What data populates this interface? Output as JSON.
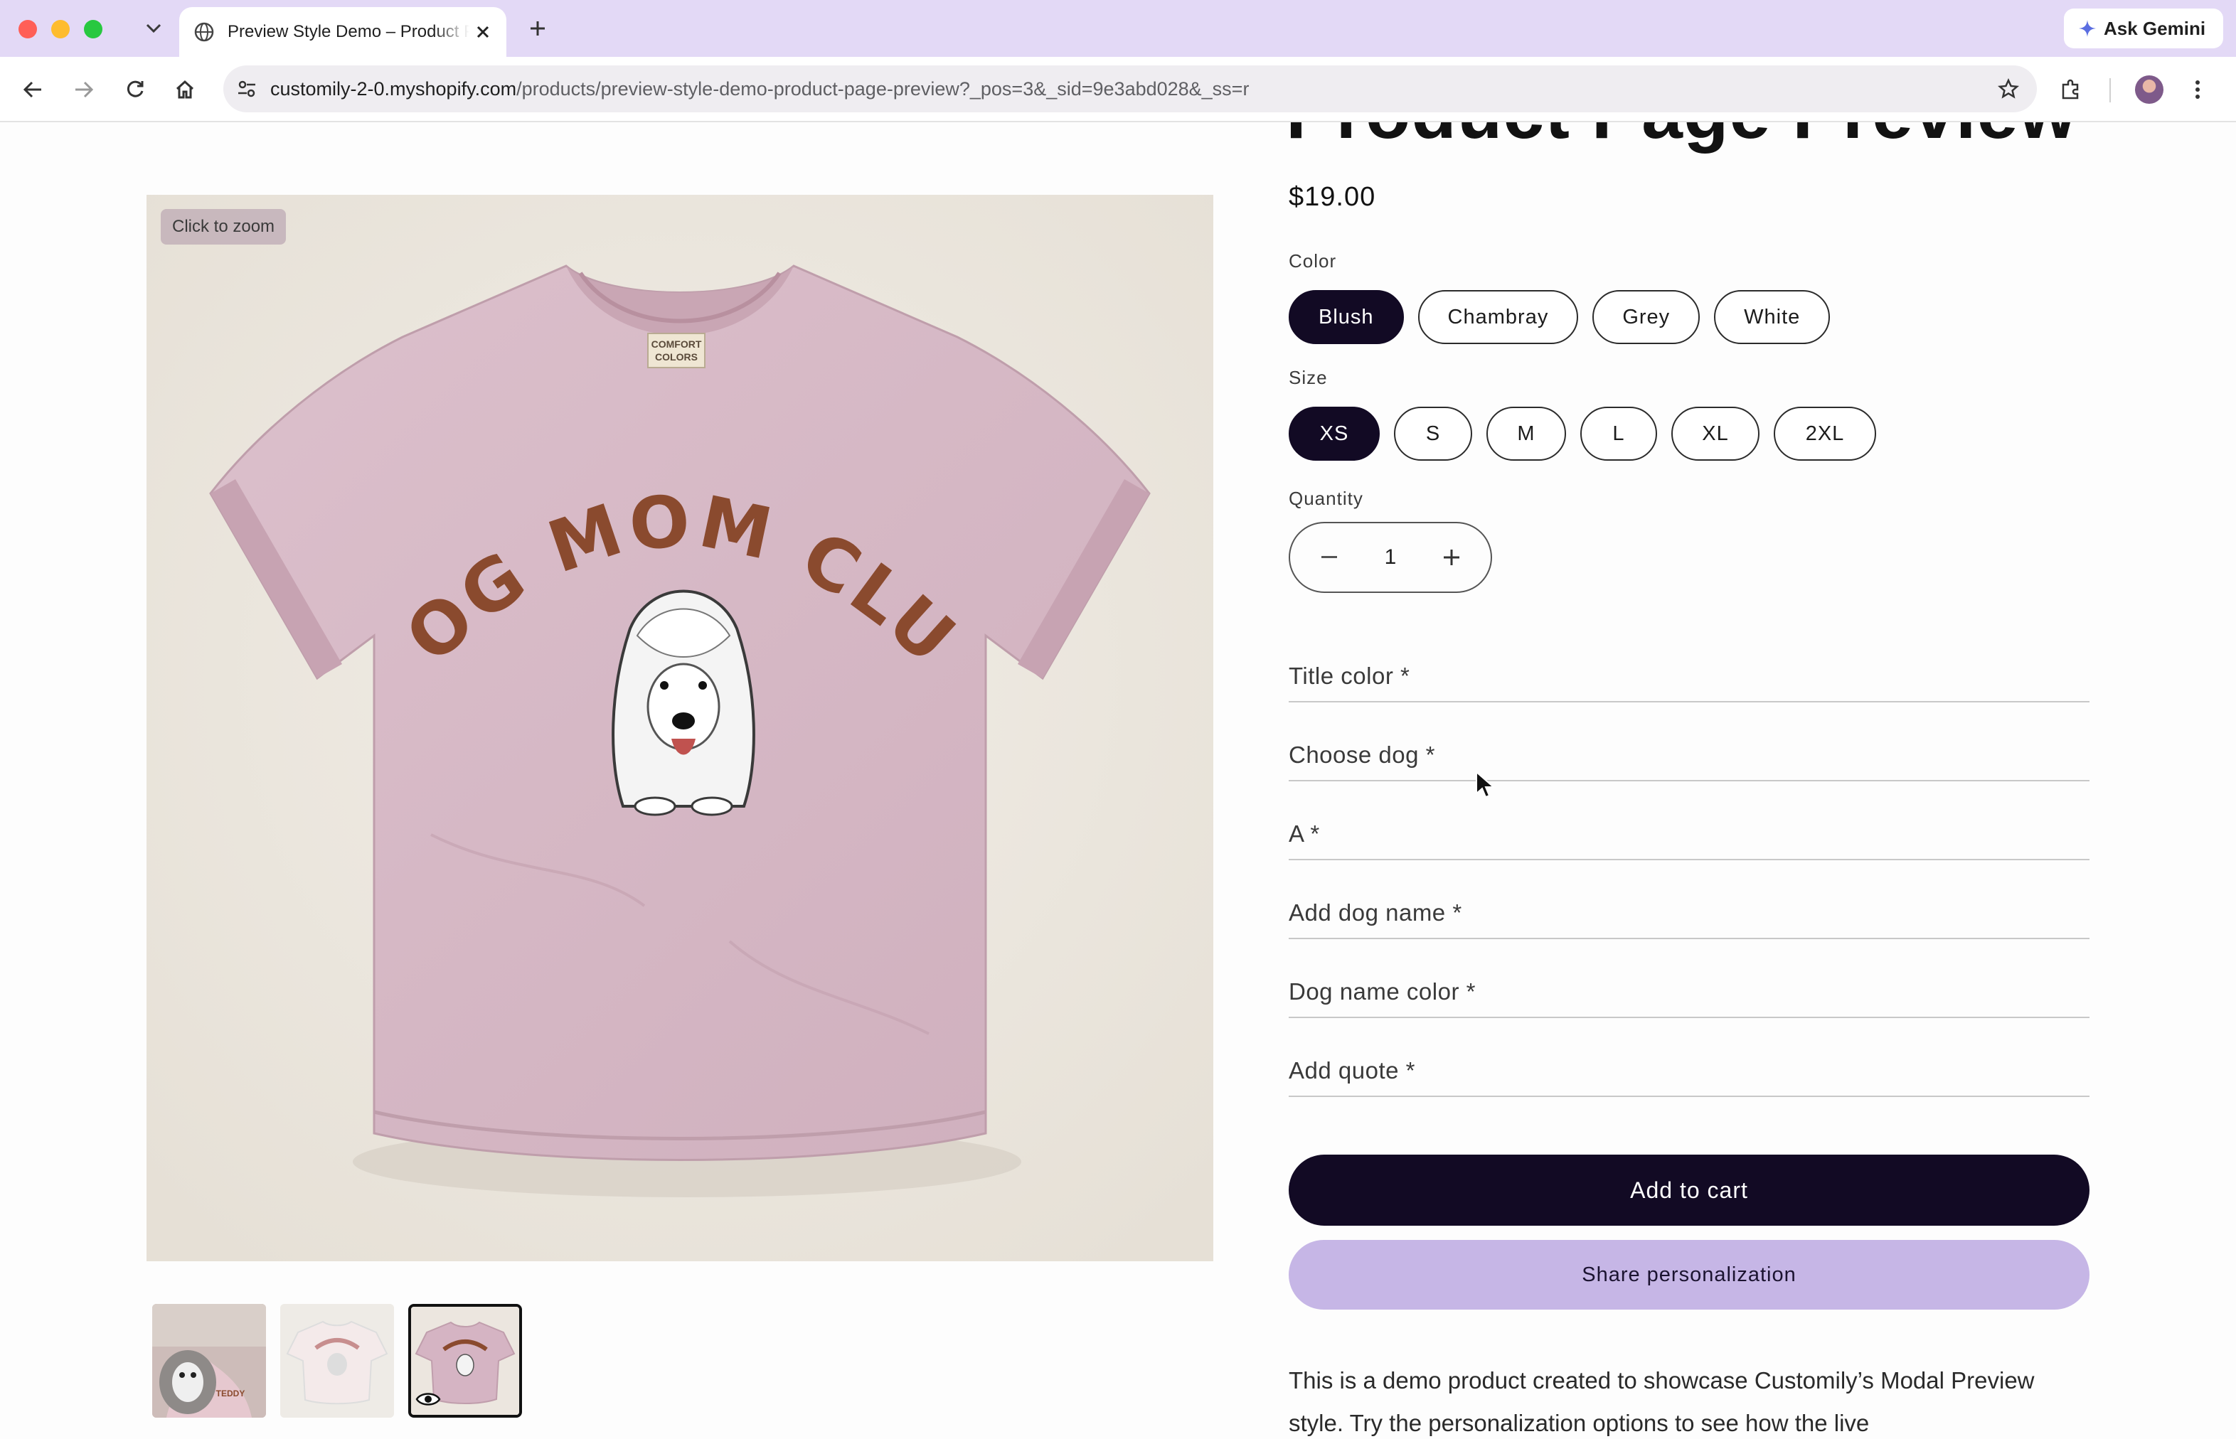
{
  "browser": {
    "tab_title": "Preview Style Demo – Product Page Preview",
    "url_host": "customily-2-0.myshopify.com",
    "url_path": "/products/preview-style-demo-product-page-preview?_pos=3&_sid=9e3abd028&_ss=r",
    "ask_gemini_label": "Ask Gemini"
  },
  "product": {
    "title_fragment": "Product Page Preview",
    "price": "$19.00",
    "zoom_label": "Click to zoom",
    "shirt_print_text": "DOG MOM CLUB",
    "tag_text_1": "COMFORT",
    "tag_text_2": "COLORS",
    "thumb_print_text": "TEDDY"
  },
  "color": {
    "label": "Color",
    "options": [
      "Blush",
      "Chambray",
      "Grey",
      "White"
    ],
    "selected": "Blush"
  },
  "size": {
    "label": "Size",
    "options": [
      "XS",
      "S",
      "M",
      "L",
      "XL",
      "2XL"
    ],
    "selected": "XS"
  },
  "quantity": {
    "label": "Quantity",
    "value": "1"
  },
  "personalization_fields": [
    "Title color *",
    "Choose dog *",
    "A *",
    "Add dog name *",
    "Dog name color *",
    "Add quote *"
  ],
  "buttons": {
    "add_to_cart": "Add to cart",
    "share": "Share personalization"
  },
  "description": "This is a demo product created to showcase Customily’s Modal Preview style. Try the personalization options to see how the live",
  "colors": {
    "chrome_tab_strip": "#e3d9f6",
    "primary_button": "#120a24",
    "share_button": "#c6b6e6",
    "shirt": "#d9bcc8",
    "print": "#8a4a2e"
  }
}
